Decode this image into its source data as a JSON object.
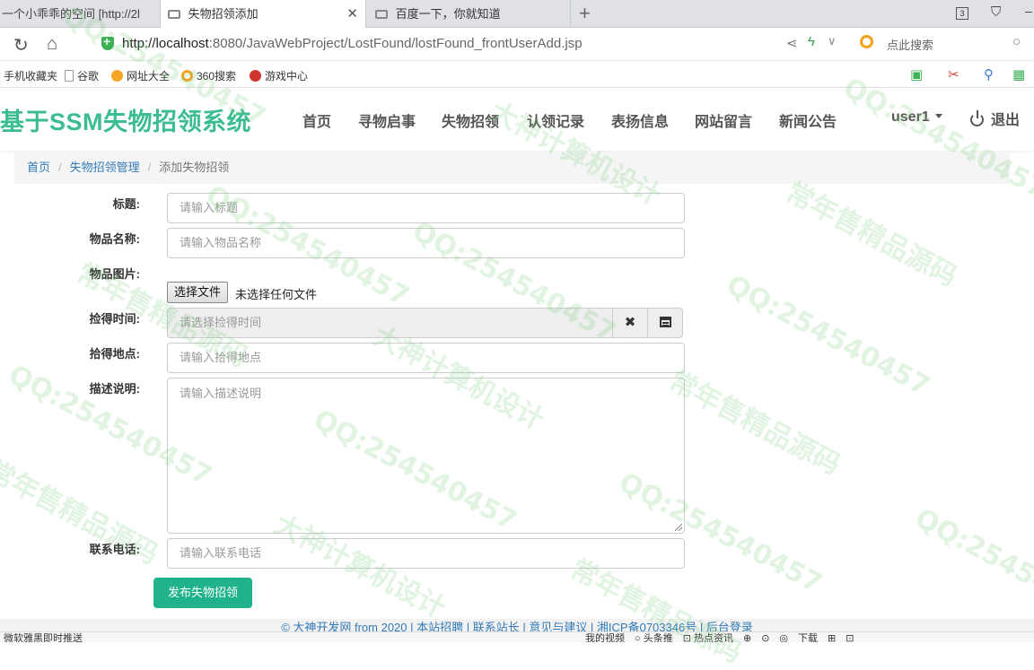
{
  "browser": {
    "tabs": [
      {
        "label": "一个小乖乖的空间 [http://2l",
        "active": false
      },
      {
        "label": "失物招领添加",
        "active": true
      },
      {
        "label": "百度一下，你就知道",
        "active": false
      }
    ],
    "new_tab_icon": "plus-icon",
    "tab_count_badge": "3",
    "url_host": "http://localhost",
    "url_rest": ":8080/JavaWebProject/LostFound/lostFound_frontUserAdd.jsp",
    "search_hint": "点此搜索",
    "bookmarks": [
      {
        "label": "手机收藏夹",
        "icon": "none"
      },
      {
        "label": "谷歌",
        "icon": "page-icon"
      },
      {
        "label": "网址大全",
        "icon": "globe-icon",
        "color": "#f5a623"
      },
      {
        "label": "360搜索",
        "icon": "360-icon",
        "color": "#f4a21a"
      },
      {
        "label": "游戏中心",
        "icon": "game-icon",
        "color": "#d0342c"
      }
    ]
  },
  "site": {
    "brand": "基于SSM失物招领系统",
    "menu": [
      "首页",
      "寻物启事",
      "失物招领",
      "认领记录",
      "表扬信息",
      "网站留言",
      "新闻公告"
    ],
    "user": "user1",
    "logout": "退出",
    "accent": "#3cbc92"
  },
  "breadcrumb": [
    "首页",
    "失物招领管理",
    "添加失物招领"
  ],
  "form": {
    "title_label": "标题:",
    "title_placeholder": "请输入标题",
    "name_label": "物品名称:",
    "name_placeholder": "请输入物品名称",
    "image_label": "物品图片:",
    "file_button": "选择文件",
    "file_status": "未选择任何文件",
    "time_label": "捡得时间:",
    "time_placeholder": "请选择捡得时间",
    "place_label": "拾得地点:",
    "place_placeholder": "请输入拾得地点",
    "desc_label": "描述说明:",
    "desc_placeholder": "请输入描述说明",
    "phone_label": "联系电话:",
    "phone_placeholder": "请输入联系电话",
    "submit": "发布失物招领",
    "submit_color": "#1fb28b"
  },
  "footer": "© 大神开发网 from 2020 | 本站招聘 | 联系站长 | 意见与建议 | 湘ICP备0703346号 | 后台登录",
  "statusbar": {
    "left": "微软雅黑即时推送",
    "right": "我的视频　○ 头条推　⊡ 热点资讯　⊕　⊙　◎　下载　⊞　⊡"
  },
  "watermark": {
    "a": "大神计算机设计",
    "b": "QQ:254540457",
    "c": "常年售精品源码"
  }
}
